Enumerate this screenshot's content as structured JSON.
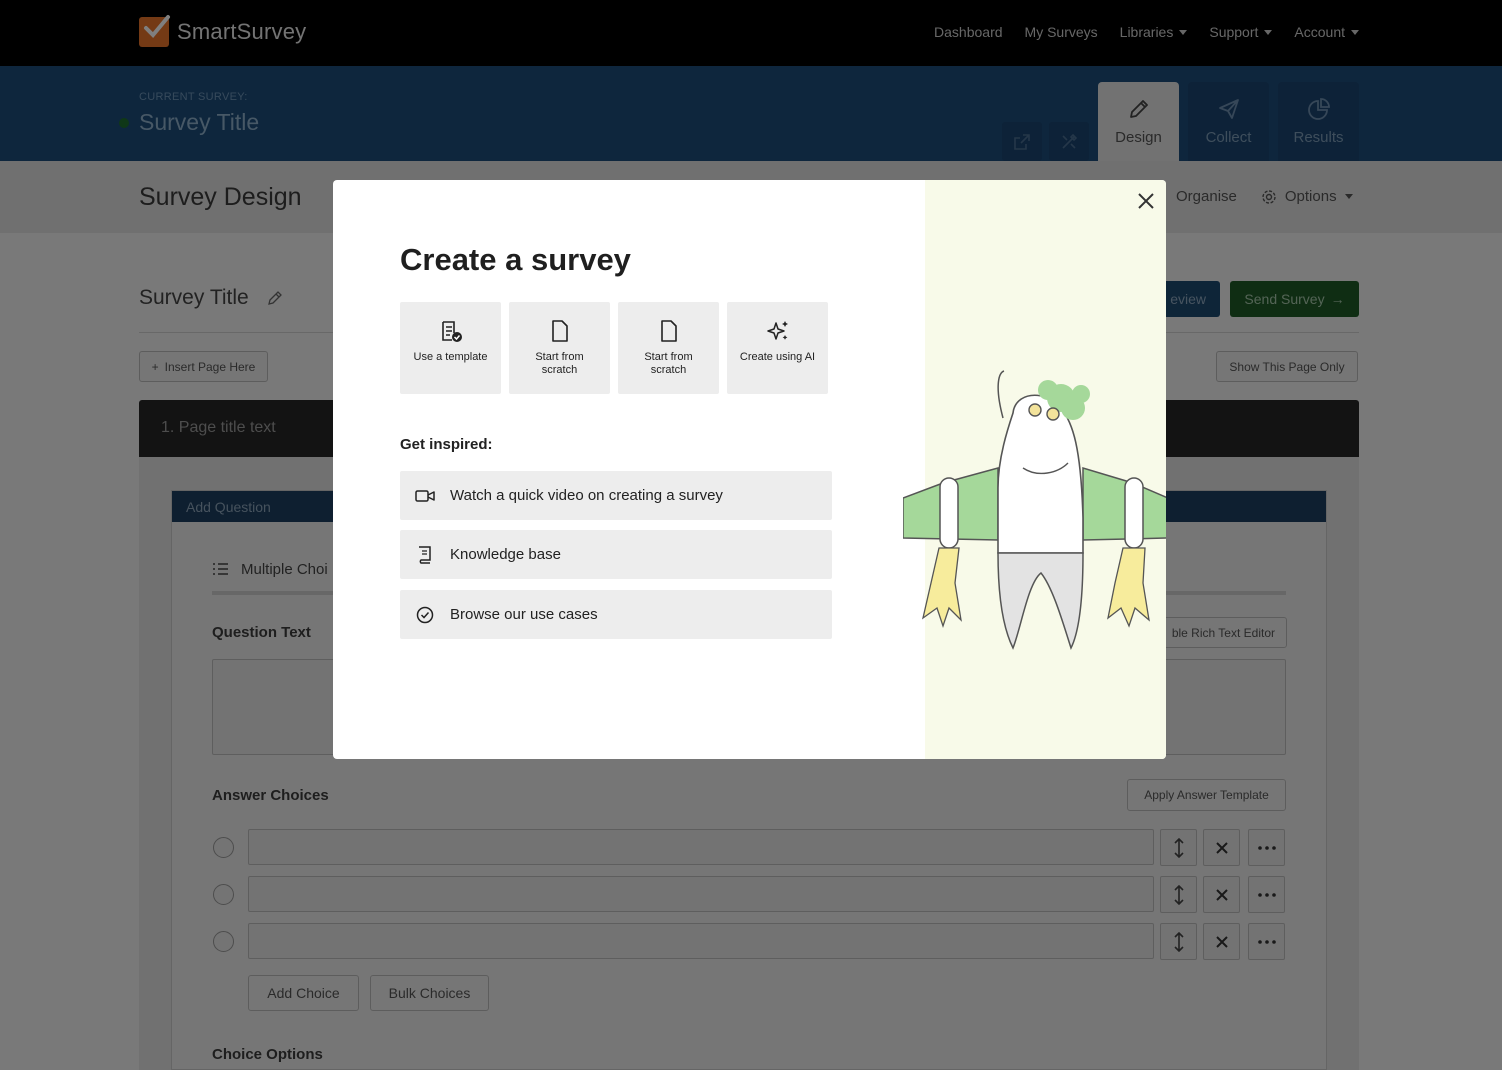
{
  "topnav": {
    "brand": "SmartSurvey",
    "links": [
      {
        "label": "Dashboard",
        "dropdown": false
      },
      {
        "label": "My Surveys",
        "dropdown": false
      },
      {
        "label": "Libraries",
        "dropdown": true
      },
      {
        "label": "Support",
        "dropdown": true
      },
      {
        "label": "Account",
        "dropdown": true
      }
    ]
  },
  "survey_header": {
    "current_label": "CURRENT SURVEY:",
    "title": "Survey Title",
    "tabs": [
      {
        "label": "Design",
        "icon": "pencil-icon",
        "active": true
      },
      {
        "label": "Collect",
        "icon": "paper-plane-icon",
        "active": false
      },
      {
        "label": "Results",
        "icon": "pie-chart-icon",
        "active": false
      }
    ]
  },
  "subheader": {
    "title": "Survey Design",
    "organise": "Organise",
    "options": "Options"
  },
  "main": {
    "survey_title": "Survey Title",
    "preview_label": "Preview",
    "preview_visible": "eview",
    "send_label": "Send Survey",
    "insert_page": "Insert Page Here",
    "show_page_only": "Show This Page Only",
    "page_title": "1. Page title text",
    "add_question": "Add Question",
    "question_type": "Multiple Choi",
    "question_text_label": "Question Text",
    "rich_text_toggle": "ble Rich Text Editor",
    "answer_choices_label": "Answer Choices",
    "apply_template": "Apply Answer Template",
    "add_choice": "Add Choice",
    "bulk_choices": "Bulk Choices",
    "choice_options_label": "Choice Options"
  },
  "modal": {
    "title": "Create a survey",
    "options": [
      {
        "label": "Use a template",
        "icon": "template-check-icon"
      },
      {
        "label": "Start from scratch",
        "icon": "blank-document-icon"
      },
      {
        "label": "Start from scratch",
        "icon": "blank-document-icon"
      },
      {
        "label": "Create using AI",
        "icon": "sparkles-icon"
      }
    ],
    "inspired_heading": "Get inspired:",
    "inspired_items": [
      {
        "label": "Watch a quick video on creating a survey",
        "icon": "video-camera-icon"
      },
      {
        "label": "Knowledge base",
        "icon": "book-icon"
      },
      {
        "label": "Browse our use cases",
        "icon": "check-circle-icon"
      }
    ]
  },
  "colors": {
    "topnav": "#000000",
    "band": "#1c4d7a",
    "send_green": "#1e5a27",
    "illustration_bg": "#f8fae9",
    "brand_orange": "#e8742a"
  }
}
